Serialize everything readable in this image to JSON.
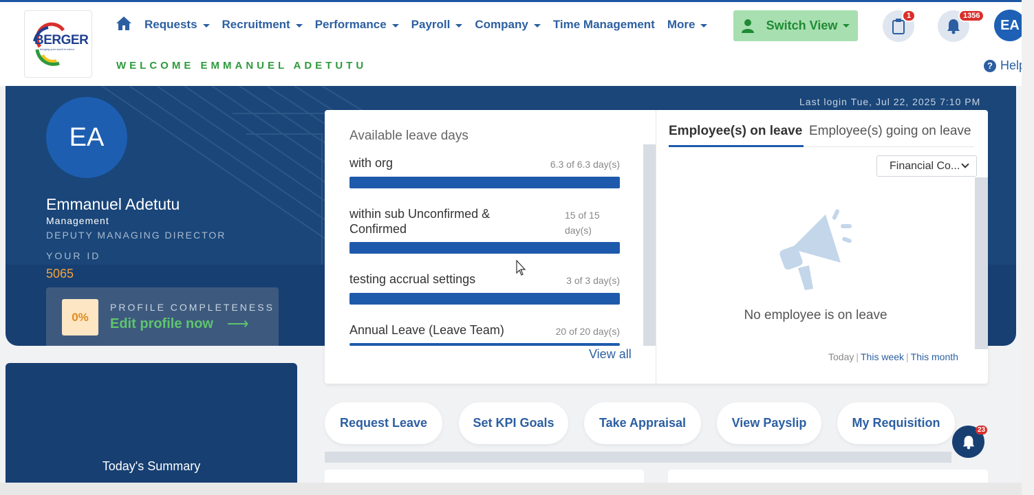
{
  "brand": {
    "logo_text": "BERGER",
    "logo_tagline": "bringing your world in colour"
  },
  "nav": {
    "items": [
      {
        "label": "Requests",
        "dropdown": true
      },
      {
        "label": "Recruitment",
        "dropdown": true
      },
      {
        "label": "Performance",
        "dropdown": true
      },
      {
        "label": "Payroll",
        "dropdown": true
      },
      {
        "label": "Company",
        "dropdown": true
      },
      {
        "label": "Time Management",
        "dropdown": false
      },
      {
        "label": "More",
        "dropdown": true
      }
    ]
  },
  "welcome": "WELCOME EMMANUEL ADETUTU",
  "switch_view": {
    "label": "Switch View"
  },
  "clipboard_badge": "1",
  "notifications_badge": "1356",
  "user_initials": "EA",
  "help_label": "Help",
  "last_login": "Last login Tue, Jul 22, 2025 7:10 PM",
  "profile": {
    "initials": "EA",
    "name": "Emmanuel Adetutu",
    "department": "Management",
    "role": "DEPUTY MANAGING DIRECTOR",
    "id_label": "YOUR ID",
    "id_value": "5065",
    "completeness_pct": "0%",
    "completeness_label": "PROFILE COMPLETENESS",
    "edit_link": "Edit profile now"
  },
  "available_leave": {
    "title": "Available leave days",
    "items": [
      {
        "name": "with org",
        "value": "6.3 of 6.3 day(s)",
        "fraction": 1.0
      },
      {
        "name": "within sub Unconfirmed & Confirmed",
        "value": "15 of 15 day(s)",
        "fraction": 1.0
      },
      {
        "name": "testing accrual settings",
        "value": "3 of 3 day(s)",
        "fraction": 1.0
      },
      {
        "name": "Annual Leave (Leave Team)",
        "value": "20 of 20 day(s)",
        "fraction": 1.0
      }
    ],
    "view_all": "View all"
  },
  "employees_leave": {
    "tabs": [
      "Employee(s) on leave",
      "Employee(s) going on leave"
    ],
    "active_tab": 0,
    "department_select": "Financial Co...",
    "empty_message": "No employee is on leave",
    "time_filters": {
      "today": "Today",
      "week": "This week",
      "month": "This month"
    }
  },
  "summary_title": "Today's Summary",
  "quick_actions": [
    "Request Leave",
    "Set KPI Goals",
    "Take Appraisal",
    "View Payslip",
    "My Requisition"
  ],
  "floating_badge": "23",
  "colors": {
    "primary": "#1e5aab",
    "hero": "#173f72",
    "green": "#2e9a3c",
    "badge": "#d9302c",
    "orange": "#f3a43a"
  },
  "icons": [
    "home-icon",
    "user-icon",
    "clipboard-icon",
    "bell-icon",
    "help-icon",
    "megaphone-icon",
    "arrow-right-icon",
    "chevron-down-icon"
  ]
}
